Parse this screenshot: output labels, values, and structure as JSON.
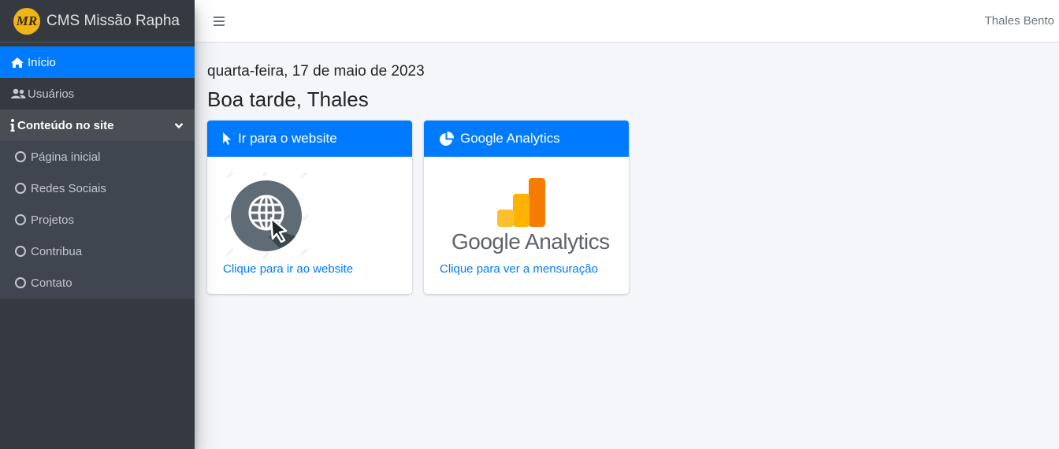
{
  "brand": {
    "logo_text": "MR",
    "title": "CMS Missão Rapha"
  },
  "sidebar": {
    "items": [
      {
        "label": "Início",
        "icon": "home-icon"
      },
      {
        "label": "Usuários",
        "icon": "users-icon"
      },
      {
        "label": "Conteúdo no site",
        "icon": "info-icon"
      }
    ],
    "subitems": [
      {
        "label": "Página inicial",
        "icon": "circle-icon"
      },
      {
        "label": "Redes Sociais",
        "icon": "circle-icon"
      },
      {
        "label": "Projetos",
        "icon": "circle-icon"
      },
      {
        "label": "Contribua",
        "icon": "circle-icon"
      },
      {
        "label": "Contato",
        "icon": "circle-icon"
      }
    ]
  },
  "navbar": {
    "user": "Thales Bento"
  },
  "main": {
    "date": "quarta-feira, 17 de maio de 2023",
    "greeting": "Boa tarde, Thales",
    "cards": [
      {
        "title": "Ir para o website",
        "link": "Clique para ir ao website"
      },
      {
        "title": "Google Analytics",
        "logo_text": "Google Analytics",
        "link": "Clique para ver a mensuração"
      }
    ]
  },
  "colors": {
    "accent": "#007bff",
    "sidebar": "#343a40",
    "background": "#f4f6f9"
  }
}
